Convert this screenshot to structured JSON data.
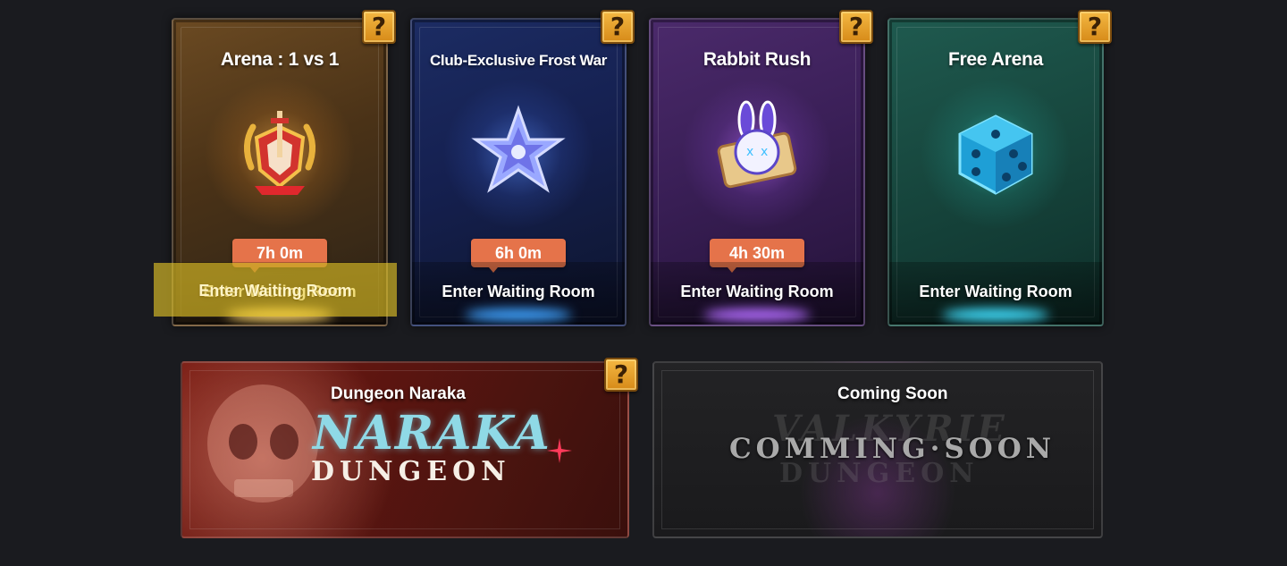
{
  "modes": [
    {
      "title": "Arena : 1 vs 1",
      "timer": "7h 0m",
      "button": "Enter Waiting Room"
    },
    {
      "title": "Club-Exclusive Frost War",
      "timer": "6h 0m",
      "button": "Enter Waiting Room"
    },
    {
      "title": "Rabbit Rush",
      "timer": "4h 30m",
      "button": "Enter Waiting Room"
    },
    {
      "title": "Free Arena",
      "button": "Enter Waiting Room"
    }
  ],
  "help_glyph": "?",
  "banners": {
    "naraka": {
      "title": "Dungeon Naraka",
      "art_script": "NARAKA",
      "art_word": "DUNGEON"
    },
    "coming_soon": {
      "title": "Coming Soon",
      "art_text": "COMMING·SOON",
      "art_ghost_1": "VALKYRIE",
      "art_ghost_2": "DUNGEON"
    }
  },
  "colors": {
    "timer_badge": "#e5734a",
    "selection_highlight": "#e8c828",
    "help_badge": "#f4b843"
  }
}
